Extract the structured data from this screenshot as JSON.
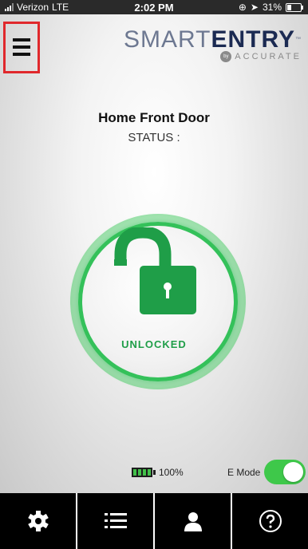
{
  "status_bar": {
    "carrier": "Verizon",
    "network": "LTE",
    "time": "2:02 PM",
    "battery": "31%"
  },
  "header": {
    "menu_icon": "hamburger-menu-icon",
    "logo_part1": "SMART",
    "logo_part2": "ENTRY",
    "logo_tm": "™",
    "logo_by": "by",
    "logo_sub": "ACCURATE"
  },
  "door": {
    "name": "Home Front Door",
    "status_label": "STATUS :",
    "lock_state": "UNLOCKED"
  },
  "device": {
    "battery_level": "100%",
    "battery_fraction": 1.0,
    "emode_label": "E Mode",
    "emode_on": true
  },
  "tabbar": {
    "items": [
      {
        "icon": "gear-icon"
      },
      {
        "icon": "list-icon"
      },
      {
        "icon": "user-icon"
      },
      {
        "icon": "help-icon"
      }
    ]
  },
  "colors": {
    "accent_green": "#34c15a",
    "lock_green": "#1f9e48",
    "logo_navy": "#1b2a52",
    "highlight_red": "#e0282c"
  }
}
